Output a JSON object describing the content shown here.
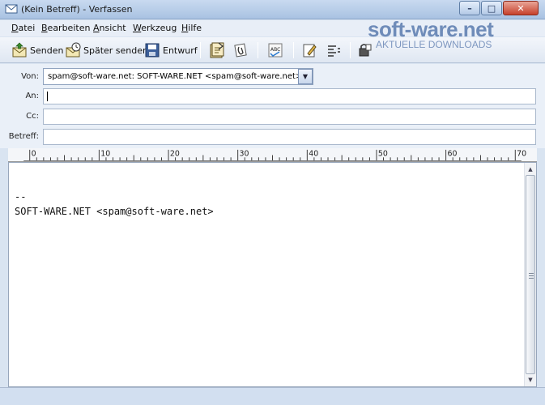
{
  "window": {
    "title": "(Kein Betreff) - Verfassen"
  },
  "menu": [
    {
      "accel": "D",
      "rest": "atei"
    },
    {
      "accel": "B",
      "rest": "earbeiten"
    },
    {
      "accel": "A",
      "rest": "nsicht"
    },
    {
      "accel": "W",
      "rest": "erkzeug"
    },
    {
      "accel": "H",
      "rest": "ilfe"
    }
  ],
  "watermark": {
    "brand": "soft-ware.net",
    "tagline": "AKTUELLE DOWNLOADS"
  },
  "toolbar": {
    "send_label": "Senden",
    "send_later_label": "Später senden",
    "draft_label": "Entwurf"
  },
  "header": {
    "from_label": "Von:",
    "from_value": "spam@soft-ware.net: SOFT-WARE.NET <spam@soft-ware.net>",
    "to_label": "An:",
    "cc_label": "Cc:",
    "subject_label": "Betreff:"
  },
  "ruler": {
    "ticks": [
      "0",
      "10",
      "20",
      "30",
      "40",
      "50",
      "60",
      "70"
    ]
  },
  "editor": {
    "signature_sep": "--",
    "signature": "SOFT-WARE.NET <spam@soft-ware.net>"
  }
}
